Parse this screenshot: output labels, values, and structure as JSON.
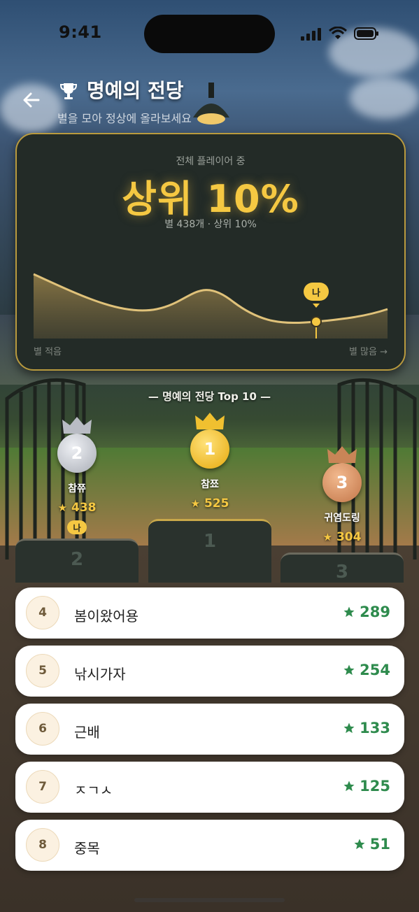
{
  "status_bar": {
    "time": "9:41"
  },
  "header": {
    "title": "명예의 전당",
    "subtitle": "별을 모아 정상에 올라보세요"
  },
  "rank_card": {
    "caption": "전체 플레이어 중",
    "rank_text": "상위 10%",
    "detail": "별 438개 · 상위 10%",
    "my_pin_label": "나",
    "axis_left": "별 적음",
    "axis_right": "별 많음 →"
  },
  "top10": {
    "heading": "— 명예의 전당 Top 10 —",
    "podium": [
      {
        "rank": "2",
        "name": "참쮸",
        "score": "438",
        "me_label": "나"
      },
      {
        "rank": "1",
        "name": "참쬬",
        "score": "525"
      },
      {
        "rank": "3",
        "name": "귀염도링",
        "score": "304"
      }
    ],
    "podium_blocks": [
      "2",
      "1",
      "3"
    ]
  },
  "list": [
    {
      "rank": "4",
      "name": "봄이왔어용",
      "score": "289"
    },
    {
      "rank": "5",
      "name": "낚시가자",
      "score": "254"
    },
    {
      "rank": "6",
      "name": "근배",
      "score": "133"
    },
    {
      "rank": "7",
      "name": "ㅈㄱㅅ",
      "score": "125"
    },
    {
      "rank": "8",
      "name": "중목",
      "score": "51"
    }
  ],
  "colors": {
    "gold": "#f5c842",
    "silver": "#c9ccd2",
    "bronze": "#d08a5c",
    "score_green": "#2e8b4d",
    "card_border": "#b99a3e"
  },
  "icons": {
    "back": "arrow-left-icon",
    "trophy": "trophy-icon",
    "star": "star-icon",
    "crown": "crown-icon"
  }
}
